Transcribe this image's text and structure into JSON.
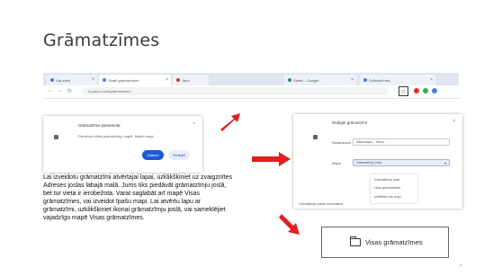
{
  "slide": {
    "title": "Grāmatzīmes",
    "page_number": "8"
  },
  "browser": {
    "tabs": [
      {
        "label": "Visi elem"
      },
      {
        "label": "Skatīt grāmatzīmes"
      },
      {
        "label": "Jaun"
      },
      {
        "label": "Saites – Google"
      },
      {
        "label": "Grāmatzīmes"
      }
    ],
    "address": "lv.yahoo.com/grāmatzīmes",
    "star_icon": "star-icon"
  },
  "popup_small": {
    "title": "Grāmatzīme pievienota",
    "text": "Pievienot kādā grāmatzīmju mapē. Mainīt mapi",
    "done_label": "Gatavs",
    "edit_label": "Rediģēt"
  },
  "popup_large": {
    "title": "Rediģēt grāmatzīmi",
    "name_label": "Nosaukums",
    "name_value": "Sākumlapa – Yahoo",
    "folder_label": "Mape",
    "folder_value": "Grāmatzīmju josla",
    "menu_items": [
      "Grāmatzīmju josla",
      "Citas grāmatzīmes",
      "Izvēlēties citu mapi..."
    ],
    "footer": "Grāmatzīmju joslas noņemšana"
  },
  "description": "Lai izveidotu grāmatzīmi atvērtajai lapai, uzklikšķiniet uz zvaigznītes Adreses joslas labajā malā. Jums tiks piedāvāt grāmatzīmju joslā, bet tur vieta ir ierobežota. Varat saglabāt arī mapē Visas grāmatzīmes, vai izveidot īpašu mapi. Lai atvērtu lapu ar grāmatzīmi, uzklikšķiniet ikonai grāmatzīmju joslā, vai sameklējiet vajadzīgo mapē Visas grāmatzīmes.",
  "folder_box": {
    "label": "Visas grāmatzīmes"
  },
  "colors": {
    "arrow": "#e02020",
    "primary_button": "#1a5bd6"
  }
}
